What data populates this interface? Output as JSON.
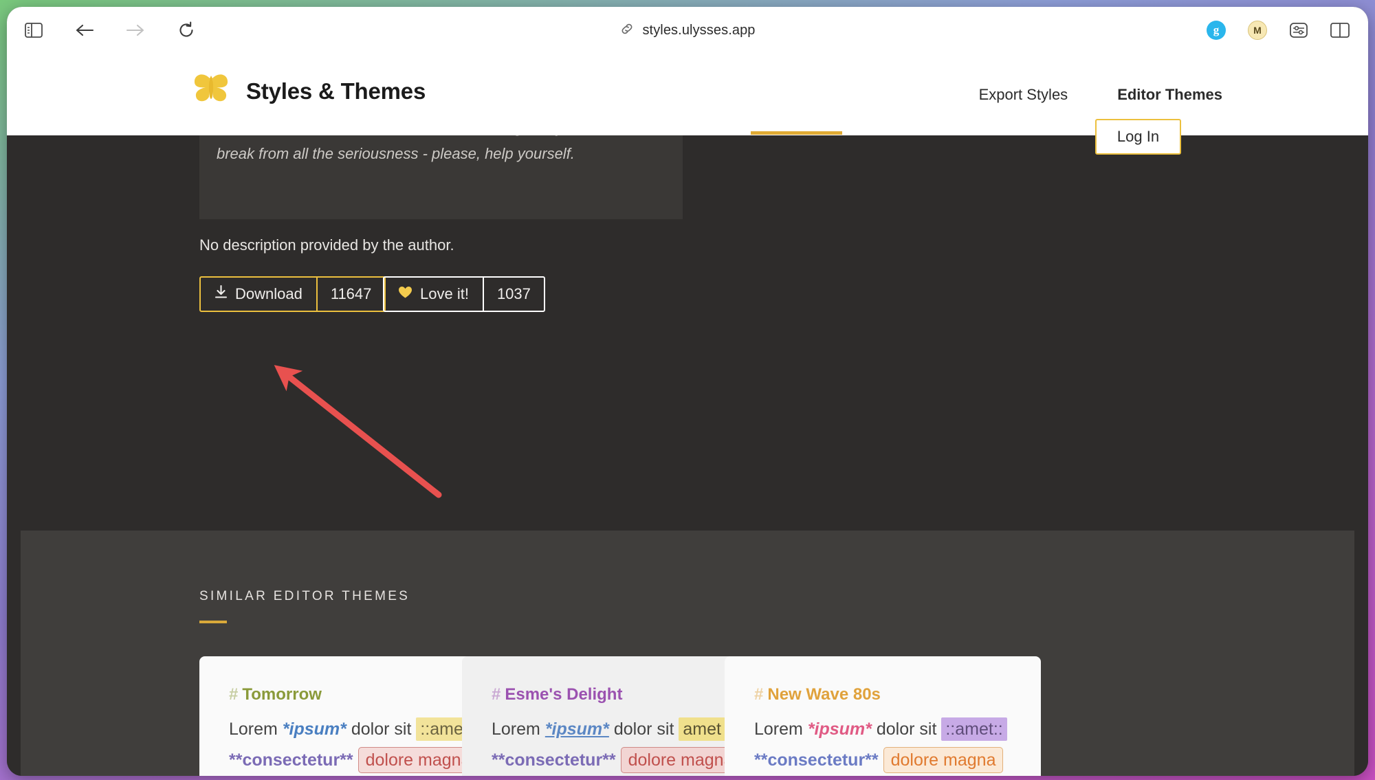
{
  "browser": {
    "url": "styles.ulysses.app",
    "url_icon": "link-icon",
    "toolbar_left": [
      {
        "name": "sidebar-toggle-icon",
        "label": "Show Sidebar"
      },
      {
        "name": "back-icon",
        "label": "Back"
      },
      {
        "name": "forward-icon",
        "label": "Forward"
      },
      {
        "name": "reload-icon",
        "label": "Reload"
      }
    ],
    "toolbar_right": [
      {
        "name": "grammarly-extension-icon",
        "label": "g",
        "color": "#2ab6ec"
      },
      {
        "name": "mercury-extension-icon",
        "label": "M",
        "color": "#f5e6b8"
      },
      {
        "name": "settings-sliders-icon",
        "label": "Page Settings"
      },
      {
        "name": "tab-overview-icon",
        "label": "Tab Overview"
      }
    ]
  },
  "site_header": {
    "brand_title": "Styles & Themes",
    "logo_icon": "butterfly-logo-icon",
    "nav": [
      {
        "label": "Export Styles",
        "active": false
      },
      {
        "label": "Editor Themes",
        "active": true
      }
    ],
    "login_label": "Log In",
    "accent_color": "#ecc03e"
  },
  "main": {
    "quote": "a dark version as vibrant as a hot summer night. If you need a break from all the seriousness - please, help yourself.",
    "no_description": "No description provided by the author.",
    "download": {
      "label": "Download",
      "icon": "download-icon",
      "count": "11647"
    },
    "love": {
      "label": "Love it!",
      "icon": "heart-icon",
      "count": "1037"
    }
  },
  "similar": {
    "title": "SIMILAR EDITOR THEMES",
    "cards": [
      {
        "name": "Tomorrow",
        "heading_color": "#8a9a3a",
        "bg": "#fafafa",
        "line1_prefix": "Lorem ",
        "em": "*ipsum*",
        "em_color": "#4a7fc1",
        "em_underline": false,
        "line1_mid": " dolor sit ",
        "mark": "::amet::",
        "mark_bg": "#f2e39a",
        "mark_color": "#6b6340",
        "line2_strong": "**consectetur**",
        "line2_strong_color": "#7b6bb5",
        "code": "dolore magna",
        "code_color": "#c0504d",
        "code_bg": "#f5dcda",
        "code_border": "#d08a86"
      },
      {
        "name": "Esme's Delight",
        "heading_color": "#9b52b0",
        "bg": "#f0f0f0",
        "line1_prefix": "Lorem ",
        "em": "*ipsum*",
        "em_color": "#5b87c4",
        "em_underline": true,
        "line1_mid": " dolor sit ",
        "mark": "amet",
        "mark_bg": "#f0e08c",
        "mark_color": "#5a5332",
        "line2_strong": "**consectetur**",
        "line2_strong_color": "#7b6bb5",
        "code": "dolore magna",
        "code_color": "#c0504d",
        "code_bg": "#f2d5d3",
        "code_border": "#cf8a86"
      },
      {
        "name": "New Wave 80s",
        "heading_color": "#e0a23c",
        "bg": "#fafafa",
        "line1_prefix": "Lorem ",
        "em": "*ipsum*",
        "em_color": "#e05a84",
        "em_underline": false,
        "line1_mid": " dolor sit ",
        "mark": "::amet::",
        "mark_bg": "#c7aae6",
        "mark_color": "#5f4d7a",
        "line2_strong": "**consectetur**",
        "line2_strong_color": "#6b7bc4",
        "code": "dolore magna",
        "code_color": "#e07a2f",
        "code_bg": "#fbe9d6",
        "code_border": "#e3b07a"
      }
    ]
  },
  "annotation": {
    "arrow_color": "#e8514f",
    "points_to": "download-button"
  }
}
